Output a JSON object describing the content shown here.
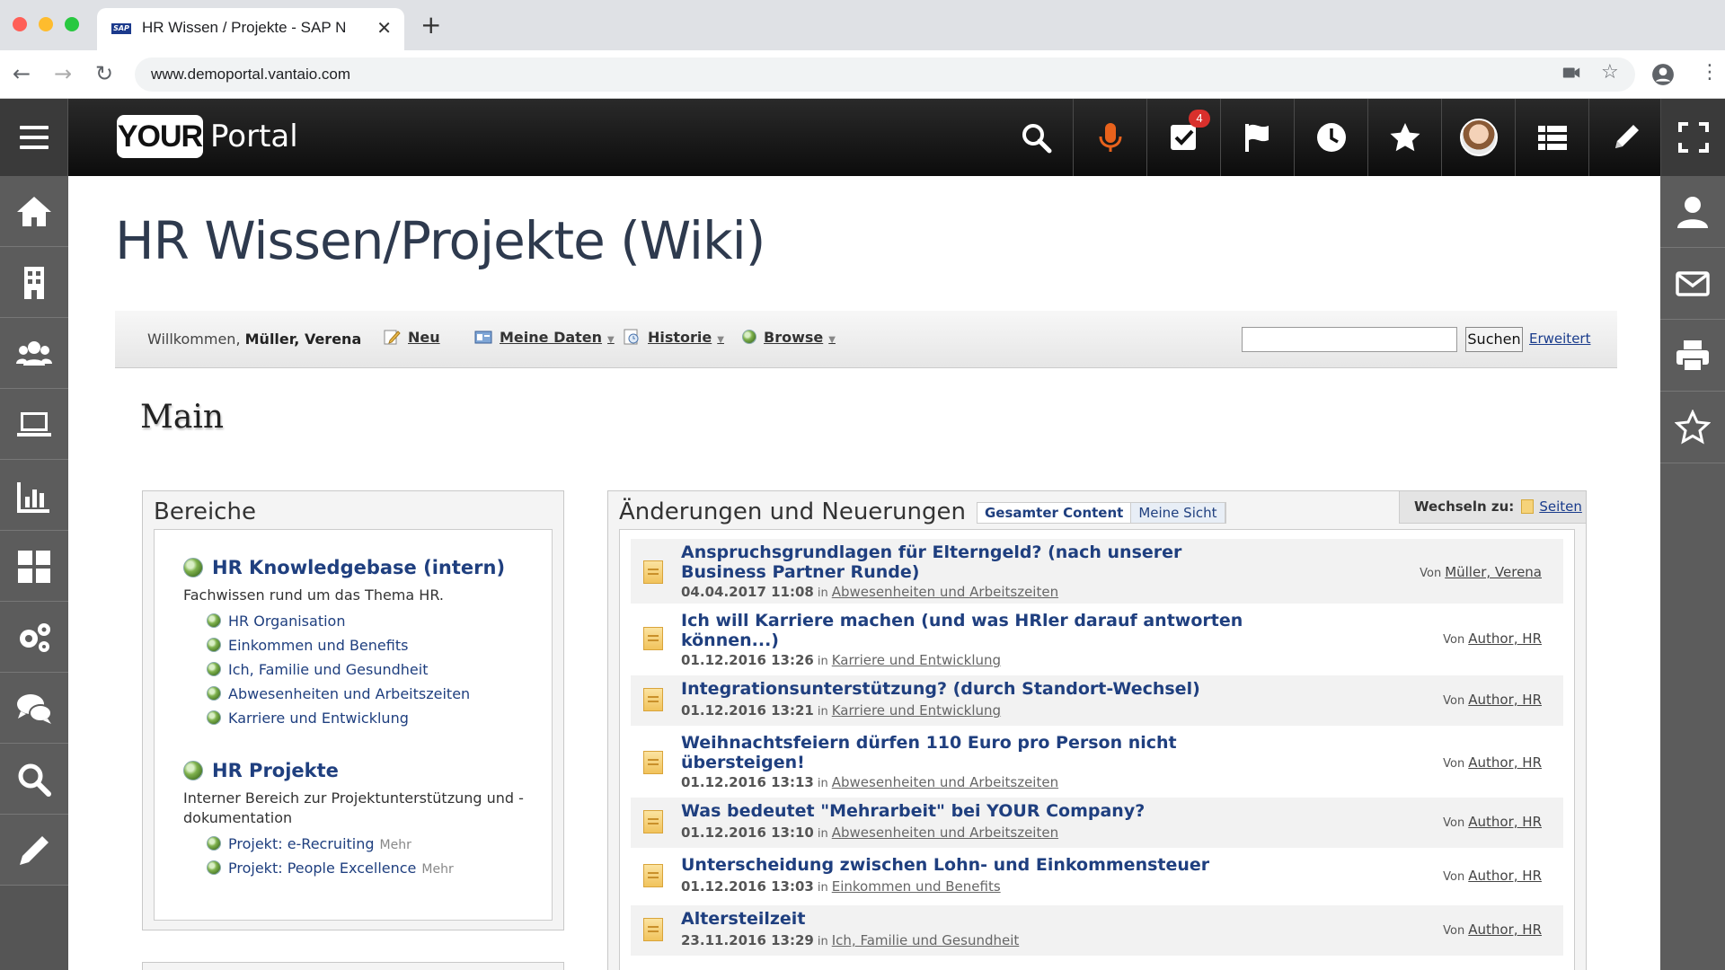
{
  "browser": {
    "tab_title": "HR Wissen / Projekte - SAP N",
    "favicon_text": "SAP",
    "url": "www.demoportal.vantaio.com"
  },
  "portal": {
    "logo_your": "YOUR",
    "logo_portal": "Portal",
    "tasks_badge": "4",
    "accent_color": "#e8621c"
  },
  "page": {
    "title": "HR Wissen/Projekte (Wiki)"
  },
  "toolbar": {
    "welcome_prefix": "Willkommen,",
    "user": "Müller, Verena",
    "new_label": "Neu",
    "mydata_label": "Meine Daten",
    "history_label": "Historie",
    "browse_label": "Browse",
    "search_button": "Suchen",
    "advanced_link": "Erweitert"
  },
  "main": {
    "heading": "Main"
  },
  "bereiche": {
    "title": "Bereiche",
    "spaces": [
      {
        "name": "HR Knowledgebase (intern)",
        "description": "Fachwissen rund um das Thema HR.",
        "links": [
          {
            "label": "HR Organisation"
          },
          {
            "label": "Einkommen und Benefits"
          },
          {
            "label": "Ich, Familie und Gesundheit"
          },
          {
            "label": "Abwesenheiten und Arbeitszeiten"
          },
          {
            "label": "Karriere und Entwicklung"
          }
        ]
      },
      {
        "name": "HR Projekte",
        "description": "Interner Bereich zur Projektunterstützung und -dokumentation",
        "links": [
          {
            "label": "Projekt: e-Recruiting",
            "more": "Mehr"
          },
          {
            "label": "Projekt: People Excellence",
            "more": "Mehr"
          }
        ]
      }
    ]
  },
  "changes": {
    "title": "Änderungen und Neuerungen",
    "tab_all": "Gesamter Content",
    "tab_mine": "Meine Sicht",
    "switch_label": "Wechseln zu:",
    "switch_link": "Seiten",
    "in_word": "in",
    "by_word": "Von",
    "items": [
      {
        "title": "Anspruchsgrundlagen für Elterngeld? (nach unserer Business Partner Runde)",
        "date": "04.04.2017 11:08",
        "category": "Abwesenheiten und Arbeitszeiten",
        "author": "Müller, Verena"
      },
      {
        "title": "Ich will Karriere machen (und was HRler darauf antworten können...)",
        "date": "01.12.2016 13:26",
        "category": "Karriere und Entwicklung",
        "author": "Author, HR"
      },
      {
        "title": "Integrationsunterstützung? (durch Standort-Wechsel)",
        "date": "01.12.2016 13:21",
        "category": "Karriere und Entwicklung",
        "author": "Author, HR"
      },
      {
        "title": "Weihnachtsfeiern dürfen 110 Euro pro Person nicht übersteigen!",
        "date": "01.12.2016 13:13",
        "category": "Abwesenheiten und Arbeitszeiten",
        "author": "Author, HR"
      },
      {
        "title": "Was bedeutet \"Mehrarbeit\" bei YOUR Company?",
        "date": "01.12.2016 13:10",
        "category": "Abwesenheiten und Arbeitszeiten",
        "author": "Author, HR"
      },
      {
        "title": "Unterscheidung zwischen Lohn- und Einkommensteuer",
        "date": "01.12.2016 13:03",
        "category": "Einkommen und Benefits",
        "author": "Author, HR"
      },
      {
        "title": "Altersteilzeit",
        "date": "23.11.2016 13:29",
        "category": "Ich, Familie und Gesundheit",
        "author": "Author, HR"
      }
    ]
  }
}
